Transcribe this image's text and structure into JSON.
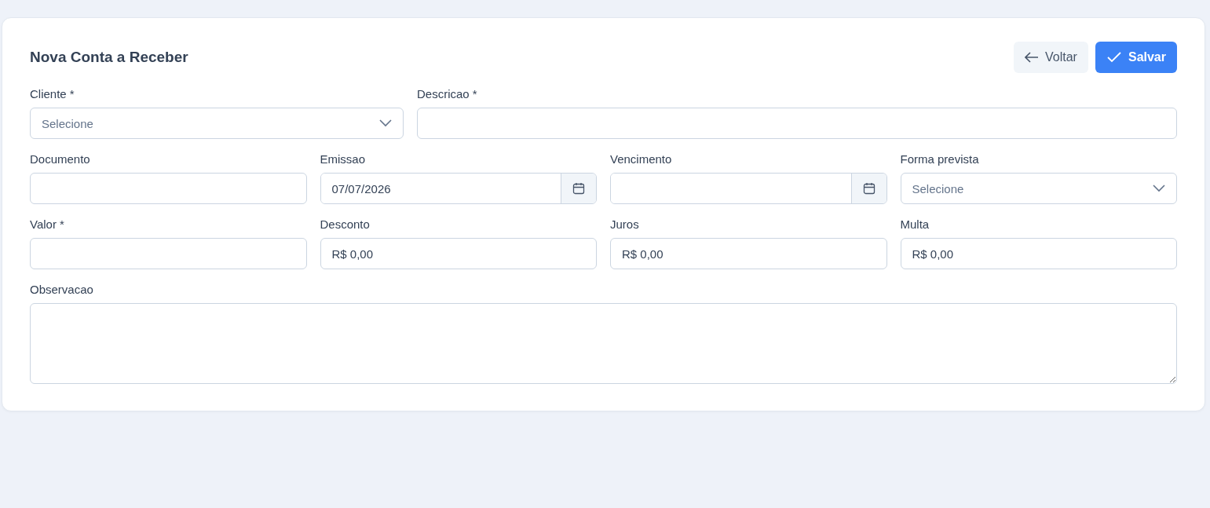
{
  "title": "Nova Conta a Receber",
  "buttons": [
    {
      "label": "Voltar",
      "kind": "secondary"
    },
    {
      "label": "Salvar",
      "kind": "primary"
    }
  ],
  "rows": [
    [
      {
        "label": "Cliente *",
        "kind": "select",
        "placeholder": "Selecione"
      },
      {
        "label": "Descricao *",
        "kind": "text"
      }
    ],
    [
      {
        "label": "Documento",
        "kind": "text"
      },
      {
        "label": "Emissao",
        "kind": "date",
        "value": "07/07/2026"
      },
      {
        "label": "Vencimento",
        "kind": "date"
      },
      {
        "label": "Forma prevista",
        "kind": "select",
        "placeholder": "Selecione"
      }
    ],
    [
      {
        "label": "Valor *",
        "kind": "text"
      },
      {
        "label": "Desconto",
        "kind": "text",
        "value": "R$ 0,00"
      },
      {
        "label": "Juros",
        "kind": "text",
        "value": "R$ 0,00"
      },
      {
        "label": "Multa",
        "kind": "text",
        "value": "R$ 0,00"
      }
    ],
    [
      {
        "label": "Observacao",
        "kind": "textarea"
      }
    ]
  ]
}
